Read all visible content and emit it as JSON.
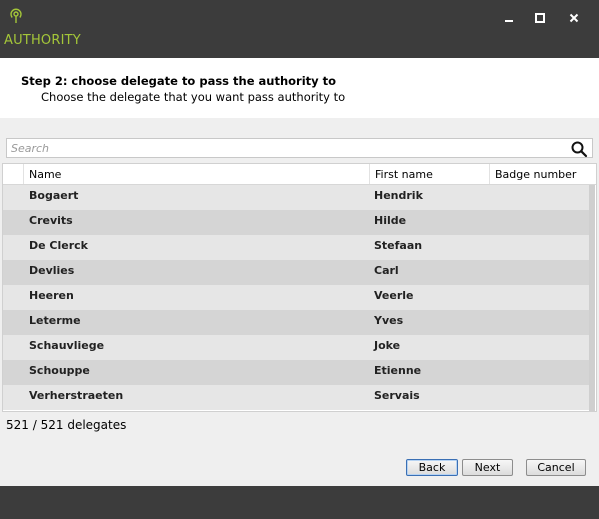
{
  "window": {
    "title": "AUTHORITY",
    "app_icon": "broadcast-icon",
    "accent_color": "#a4c639",
    "controls": [
      "minimize-icon",
      "maximize-icon",
      "close-icon"
    ]
  },
  "header": {
    "step_title": "Step 2: choose delegate to pass the authority to",
    "step_subtitle": "Choose the delegate that you want pass authority to"
  },
  "search": {
    "placeholder": "Search",
    "icon": "search-icon"
  },
  "table": {
    "columns": [
      "Name",
      "First name",
      "Badge number"
    ],
    "rows": [
      {
        "name": "Bogaert",
        "first_name": "Hendrik",
        "badge": ""
      },
      {
        "name": "Crevits",
        "first_name": "Hilde",
        "badge": ""
      },
      {
        "name": "De Clerck",
        "first_name": "Stefaan",
        "badge": ""
      },
      {
        "name": "Devlies",
        "first_name": "Carl",
        "badge": ""
      },
      {
        "name": "Heeren",
        "first_name": "Veerle",
        "badge": ""
      },
      {
        "name": "Leterme",
        "first_name": "Yves",
        "badge": ""
      },
      {
        "name": "Schauvliege",
        "first_name": "Joke",
        "badge": ""
      },
      {
        "name": "Schouppe",
        "first_name": "Etienne",
        "badge": ""
      },
      {
        "name": "Verherstraeten",
        "first_name": "Servais",
        "badge": ""
      }
    ]
  },
  "count": {
    "shown": "521",
    "separator": "/",
    "total": "521",
    "label": "delegates"
  },
  "buttons": {
    "back": "Back",
    "next": "Next",
    "cancel": "Cancel"
  }
}
